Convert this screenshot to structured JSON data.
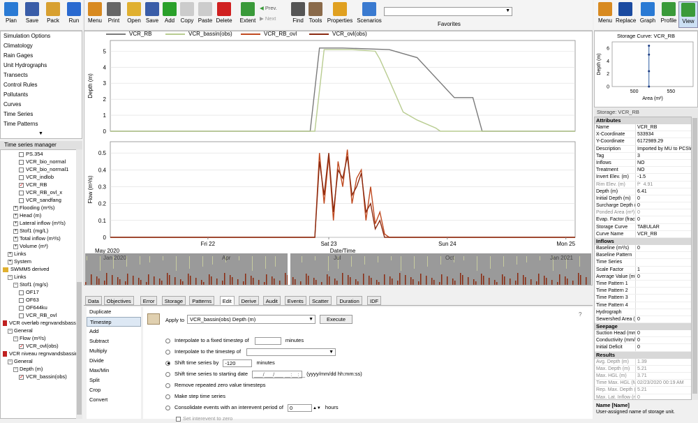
{
  "toolbar_left": [
    {
      "label": "Plan",
      "icon": "plan-icon",
      "color": "#2a7ad4"
    },
    {
      "label": "Save",
      "icon": "save-icon",
      "color": "#3a5da8"
    },
    {
      "label": "Pack",
      "icon": "pack-icon",
      "color": "#d8a030"
    },
    {
      "label": "Run",
      "icon": "run-icon",
      "color": "#2a6ad0"
    }
  ],
  "toolbar_main": [
    {
      "label": "Menu",
      "icon": "menu-icon",
      "color": "#d88a20"
    },
    {
      "label": "Print",
      "icon": "print-icon",
      "color": "#666666"
    },
    {
      "label": "Open",
      "icon": "open-folder-icon",
      "color": "#e0b030"
    },
    {
      "label": "Save",
      "icon": "save-icon",
      "color": "#3a5da8"
    },
    {
      "label": "Add",
      "icon": "add-icon",
      "color": "#2aa02a"
    },
    {
      "label": "Copy",
      "icon": "copy-icon",
      "color": "#cccccc"
    },
    {
      "label": "Paste",
      "icon": "paste-icon",
      "color": "#cccccc"
    },
    {
      "label": "Delete",
      "icon": "delete-icon",
      "color": "#d02020"
    },
    {
      "label": "Extent",
      "icon": "extent-icon",
      "color": "#3a9a3a"
    },
    {
      "label": "Find",
      "icon": "binoculars-icon",
      "color": "#555555"
    },
    {
      "label": "Tools",
      "icon": "tools-icon",
      "color": "#8a6a4a"
    },
    {
      "label": "Properties",
      "icon": "properties-icon",
      "color": "#e0a020"
    },
    {
      "label": "Scenarios",
      "icon": "scenarios-icon",
      "color": "#3a7ad0"
    }
  ],
  "prev_label": "Prev.",
  "next_label": "Next",
  "favorites_label": "Favorites",
  "toolbar_right": [
    {
      "label": "Menu",
      "icon": "menu-icon",
      "color": "#d88a20"
    },
    {
      "label": "Replace",
      "icon": "fx-icon",
      "color": "#1a4aa0"
    },
    {
      "label": "Graph",
      "icon": "graph-icon",
      "color": "#2a7ad4"
    },
    {
      "label": "Profile",
      "icon": "profile-icon",
      "color": "#3a9a3a"
    },
    {
      "label": "View",
      "icon": "view-icon",
      "color": "#3a9a3a"
    }
  ],
  "nav_list": [
    "Simulation Options",
    "Climatology",
    "Rain Gages",
    "Unit Hydrographs",
    "Transects",
    "Control Rules",
    "Pollutants",
    "Curves",
    "Time Series",
    "Time Patterns"
  ],
  "ts_manager_title": "Time series manager",
  "tree": [
    {
      "label": "PS.354",
      "indent": 2,
      "type": "cb",
      "checked": false
    },
    {
      "label": "VCR_bio_normal",
      "indent": 2,
      "type": "cb",
      "checked": false
    },
    {
      "label": "VCR_bio_normal1",
      "indent": 2,
      "type": "cb",
      "checked": false
    },
    {
      "label": "VCR_indlob",
      "indent": 2,
      "type": "cb",
      "checked": false
    },
    {
      "label": "VCR_RB",
      "indent": 2,
      "type": "cb",
      "checked": true
    },
    {
      "label": "VCR_RB_ovl_x",
      "indent": 2,
      "type": "cb",
      "checked": false
    },
    {
      "label": "VCR_sandfang",
      "indent": 2,
      "type": "cb",
      "checked": false
    },
    {
      "label": "Flooding (m³/s)",
      "indent": 1,
      "type": "exp",
      "sign": "+"
    },
    {
      "label": "Head (m)",
      "indent": 1,
      "type": "exp",
      "sign": "+"
    },
    {
      "label": "Lateral inflow (m³/s)",
      "indent": 1,
      "type": "exp",
      "sign": "+"
    },
    {
      "label": "Stof1 (mg/L)",
      "indent": 1,
      "type": "exp",
      "sign": "+"
    },
    {
      "label": "Total inflow (m³/s)",
      "indent": 1,
      "type": "exp",
      "sign": "+"
    },
    {
      "label": "Volume (m³)",
      "indent": 1,
      "type": "exp",
      "sign": "+"
    },
    {
      "label": "Links",
      "indent": 0,
      "type": "exp",
      "sign": "+"
    },
    {
      "label": "System",
      "indent": 0,
      "type": "exp",
      "sign": "+"
    },
    {
      "label": "SWMM5 derived",
      "indent": -1,
      "type": "folder"
    },
    {
      "label": "Links",
      "indent": 0,
      "type": "exp",
      "sign": "−"
    },
    {
      "label": "Stof1 (mg/s)",
      "indent": 1,
      "type": "exp",
      "sign": "−"
    },
    {
      "label": "OF17",
      "indent": 2,
      "type": "cb",
      "checked": false
    },
    {
      "label": "OF63",
      "indent": 2,
      "type": "cb",
      "checked": false
    },
    {
      "label": "OF644ku",
      "indent": 2,
      "type": "cb",
      "checked": false
    },
    {
      "label": "VCR_RB_ovl",
      "indent": 2,
      "type": "cb",
      "checked": false
    },
    {
      "label": "VCR overløb regnvandsbassin",
      "indent": -1,
      "type": "redfolder"
    },
    {
      "label": "General",
      "indent": 0,
      "type": "exp",
      "sign": "−"
    },
    {
      "label": "Flow (m³/s)",
      "indent": 1,
      "type": "exp",
      "sign": "−"
    },
    {
      "label": "VCR_ovl(obs)",
      "indent": 2,
      "type": "cb",
      "checked": true
    },
    {
      "label": "VCR niveau regnvandsbassin 2",
      "indent": -1,
      "type": "redfolder"
    },
    {
      "label": "General",
      "indent": 0,
      "type": "exp",
      "sign": "−"
    },
    {
      "label": "Depth (m)",
      "indent": 1,
      "type": "exp",
      "sign": "−"
    },
    {
      "label": "VCR_bassin(obs)",
      "indent": 2,
      "type": "cb",
      "checked": true
    }
  ],
  "legend": [
    {
      "name": "VCR_RB",
      "color": "#7a7a7a"
    },
    {
      "name": "VCR_bassin(obs)",
      "color": "#b8cc90"
    },
    {
      "name": "VCR_RB_ovl",
      "color": "#c04a20"
    },
    {
      "name": "VCR_ovl(obs)",
      "color": "#8a2a10"
    }
  ],
  "chart_data": [
    {
      "type": "line",
      "ylabel": "Depth (m)",
      "ylim": [
        0,
        5.5
      ],
      "yticks": [
        "0",
        "1",
        "2",
        "3",
        "4",
        "5"
      ],
      "series": [
        {
          "name": "VCR_RB",
          "color": "#7a7a7a",
          "x": [
            0,
            43,
            45,
            50,
            60,
            66,
            74,
            75,
            78,
            80,
            100
          ],
          "y": [
            0,
            0,
            5.2,
            5.2,
            5.1,
            4.6,
            2.1,
            2.1,
            2.1,
            0,
            0
          ]
        },
        {
          "name": "VCR_bassin(obs)",
          "color": "#b8cc90",
          "x": [
            0,
            44,
            46,
            52,
            57,
            58,
            60,
            63,
            66,
            70,
            71,
            100
          ],
          "y": [
            0,
            0,
            5.1,
            5.1,
            5.0,
            4.5,
            3.2,
            1.2,
            0.7,
            0.2,
            0,
            0
          ]
        }
      ]
    },
    {
      "type": "line",
      "ylabel": "Flow (m³/s)",
      "ylim": [
        0,
        0.55
      ],
      "yticks": [
        "0",
        "0.1",
        "0.2",
        "0.3",
        "0.4",
        "0.5"
      ],
      "xticks": [
        "Fri 22",
        "Sat 23",
        "Sun 24",
        "Mon 25"
      ],
      "xlabel": "Date/Time",
      "x_start": "May 2020",
      "series": [
        {
          "name": "VCR_RB_ovl",
          "color": "#c04a20",
          "x": [
            0,
            44,
            45,
            46,
            47,
            48,
            49,
            50,
            51,
            52,
            53,
            54,
            55,
            56,
            57,
            58,
            59,
            60,
            100
          ],
          "y": [
            0,
            0,
            0.5,
            0.2,
            0.48,
            0.1,
            0.45,
            0.3,
            0.52,
            0.2,
            0.35,
            0.4,
            0.1,
            0.3,
            0.08,
            0.15,
            0.02,
            0,
            0
          ]
        },
        {
          "name": "VCR_ovl(obs)",
          "color": "#8a2a10",
          "x": [
            0,
            44,
            45,
            46,
            47,
            48,
            49,
            50,
            51,
            52,
            53,
            54,
            55,
            56,
            57,
            58,
            59,
            100
          ],
          "y": [
            0,
            0,
            0.45,
            0.25,
            0.5,
            0.15,
            0.4,
            0.35,
            0.48,
            0.25,
            0.3,
            0.38,
            0.15,
            0.2,
            0.05,
            0.1,
            0,
            0
          ]
        }
      ]
    }
  ],
  "overview": {
    "labels": [
      "Jan 2020",
      "Apr",
      "Jul",
      "Oct",
      "Jan 2021"
    ]
  },
  "tabs": [
    "Data",
    "Objectives",
    "Error",
    "Storage",
    "Patterns",
    "Edit",
    "Derive",
    "Audit",
    "Events",
    "Scatter",
    "Duration",
    "IDF"
  ],
  "active_tab": "Edit",
  "edit_ops": [
    "Duplicate",
    "Timestep",
    "Add",
    "Subtract",
    "Multiply",
    "Divide",
    "Max/Min",
    "Split",
    "Crop",
    "Convert"
  ],
  "active_op": "Timestep",
  "apply_to_label": "Apply to",
  "apply_to_value": "VCR_bassin(obs) Depth (m)",
  "execute_label": "Execute",
  "help_label": "?",
  "options": {
    "fixed_timestep": "Interpolate to a fixed timestep of",
    "minutes": "minutes",
    "timestep_of": "Interpolate to the timestep of",
    "shift_by": "Shift time series by",
    "shift_value": "-120",
    "shift_start": "Shift time series to starting date",
    "date_placeholder": "___/___/___ __:__:__",
    "date_format": "(yyyy/mm/dd hh:mm:ss)",
    "remove_zero": "Remove repeated zero value timesteps",
    "make_step": "Make step time series",
    "consolidate": "Consolidate events with an interevent period of",
    "consolidate_value": "0",
    "hours": "hours",
    "set_interevent": "Set interevent to zero"
  },
  "storage_curve": {
    "title": "Storage Curve: VCR_RB",
    "ylabel": "Depth (m)",
    "xlabel": "Area (m²)",
    "yticks": [
      "0",
      "2",
      "4",
      "6"
    ],
    "xticks": [
      "500",
      "550"
    ],
    "points": [
      {
        "area": 520,
        "depth": 0
      },
      {
        "area": 520,
        "depth": 2.4
      },
      {
        "area": 520,
        "depth": 5
      },
      {
        "area": 520,
        "depth": 6.4
      }
    ]
  },
  "props_title": "Storage: VCR_RB",
  "props": [
    {
      "cat": "Attributes"
    },
    {
      "n": "Name",
      "v": "VCR_RB"
    },
    {
      "n": "X-Coordinate",
      "v": "533934"
    },
    {
      "n": "Y-Coordinate",
      "v": "6172989.29"
    },
    {
      "n": "Description",
      "v": "Imported by MU to PCSW"
    },
    {
      "n": "Tag",
      "v": "3"
    },
    {
      "n": "Inflows",
      "v": "NO"
    },
    {
      "n": "Treatment",
      "v": "NO"
    },
    {
      "n": "Invert Elev. (m)",
      "v": "-1.5"
    },
    {
      "n": "Rim Elev. (m)",
      "v": "4.91",
      "f": "f*",
      "grey": true
    },
    {
      "n": "Depth (m)",
      "v": "6.41"
    },
    {
      "n": "Initial Depth (m)",
      "v": "0"
    },
    {
      "n": "Surcharge Depth (m)",
      "v": "0"
    },
    {
      "n": "Ponded Area (m²)",
      "v": "0",
      "grey": true
    },
    {
      "n": "Evap. Factor (fraction)",
      "v": "0"
    },
    {
      "n": "Storage Curve",
      "v": "TABULAR"
    },
    {
      "n": "Curve Name",
      "v": "VCR_RB"
    },
    {
      "cat": "Inflows"
    },
    {
      "n": "Baseline (m³/s)",
      "v": "0"
    },
    {
      "n": "Baseline Pattern",
      "v": ""
    },
    {
      "n": "Time Series",
      "v": ""
    },
    {
      "n": "Scale Factor",
      "v": "1"
    },
    {
      "n": "Average Value (m³/s)",
      "v": "0"
    },
    {
      "n": "Time Pattern 1",
      "v": ""
    },
    {
      "n": "Time Pattern 2",
      "v": ""
    },
    {
      "n": "Time Pattern 3",
      "v": ""
    },
    {
      "n": "Time Pattern 4",
      "v": ""
    },
    {
      "n": "Hydrograph",
      "v": ""
    },
    {
      "n": "Sewershed Area (ha)",
      "v": "0"
    },
    {
      "cat": "Seepage"
    },
    {
      "n": "Suction Head (mm)",
      "v": "0"
    },
    {
      "n": "Conductivity (mm/hr)",
      "v": "0"
    },
    {
      "n": "Initial Deficit",
      "v": "0"
    },
    {
      "cat": "Results"
    },
    {
      "n": "Avg. Depth (m)",
      "v": "1.39",
      "grey": true
    },
    {
      "n": "Max. Depth (m)",
      "v": "5.21",
      "grey": true
    },
    {
      "n": "Max. HGL (m)",
      "v": "3.71",
      "grey": true
    },
    {
      "n": "Time Max. HGL (Mon)",
      "v": "02/23/2020 00:19 AM",
      "grey": true
    },
    {
      "n": "Rep. Max. Depth (m)",
      "v": "5.21",
      "grey": true
    },
    {
      "n": "Max. Lat. Inflow (m³/s)",
      "v": "0",
      "grey": true
    }
  ],
  "desc_title": "Name [Name]",
  "desc_text": "User-assigned name of storage unit."
}
